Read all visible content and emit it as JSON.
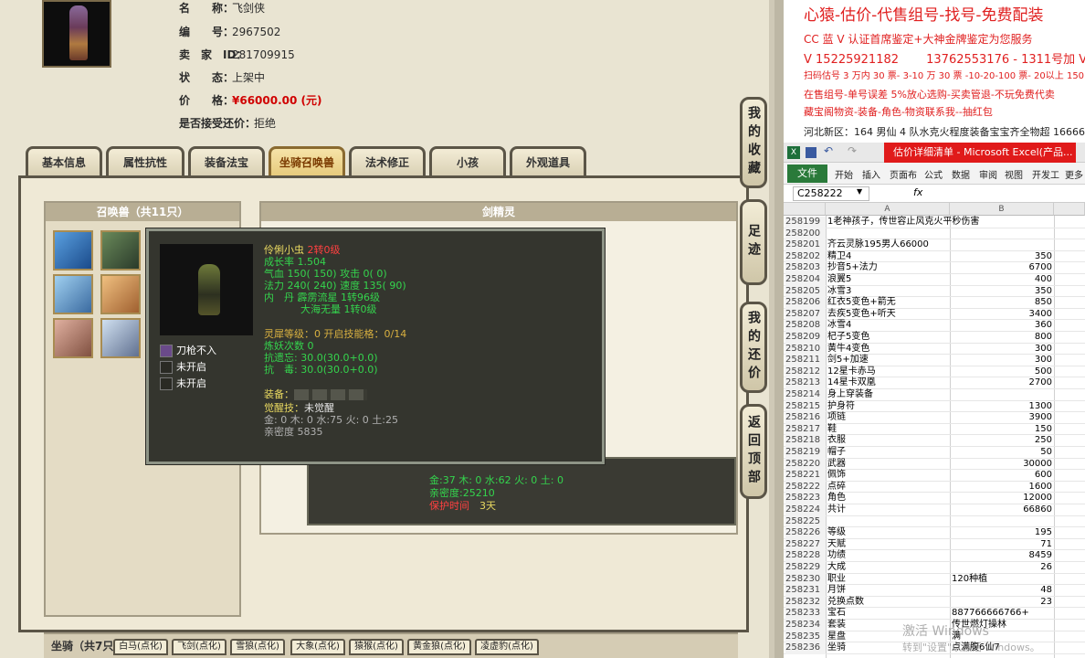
{
  "listing": {
    "name_label": "名　　称：",
    "name": "飞剑侠",
    "id_label": "编　　号：",
    "id": "2967502",
    "seller_label": "卖　家　ID：",
    "seller": "281709915",
    "status_label": "状　　态：",
    "status": "上架中",
    "price_label": "价　　格：",
    "price": "¥66000.00 (元)",
    "bargain_label": "是否接受还价：",
    "bargain": "拒绝"
  },
  "tabs": [
    "基本信息",
    "属性抗性",
    "装备法宝",
    "坐骑召唤兽",
    "法术修正",
    "小孩",
    "外观道具"
  ],
  "pet_panel": {
    "title": "召唤兽（共11只）"
  },
  "detail_panel": {
    "title": "剑精灵"
  },
  "tooltip": {
    "name": "伶俐小虫",
    "level": "2转0级",
    "growth": "成长率 1.504",
    "qi": "气血 150( 150) 攻击 0( 0)",
    "fa": "法力 240( 240) 速度 135( 90)",
    "neidan1": "内　丹 霹雳流星 1转96级",
    "neidan2": "大海无量 1转0级",
    "spirit": "灵犀等级：0 开启技能格：0/14",
    "refine": "炼妖次数 0",
    "resist1": "抗遗忘: 30.0(30.0+0.0)",
    "resist2": "抗　毒: 30.0(30.0+0.0)",
    "equip_label": "装备：",
    "awaken_label": "觉醒技：",
    "awaken": "未觉醒",
    "elements": "金: 0 木: 0 水:75 火: 0 土:25",
    "intimacy": "亲密度 5835",
    "skills": [
      "刀枪不入",
      "未开启",
      "未开启"
    ]
  },
  "second_card": {
    "elements": "金:37 木: 0 水:62 火: 0 土: 0",
    "intimacy": "亲密度:25210",
    "protect_label": "保护时间",
    "protect": "3天"
  },
  "side_buttons": [
    "我的收藏",
    "足迹",
    "我的还价",
    "返回顶部"
  ],
  "mount": {
    "label": "坐骑（共7只）",
    "tabs": [
      "白马(点化)",
      "飞剑(点化)",
      "雪狼(点化)",
      "大象(点化)",
      "猿猴(点化)",
      "黄金狼(点化)",
      "凌虚豹(点化)"
    ]
  },
  "ad": {
    "title": "心猿-估价-代售组号-找号-免费配装",
    "l1": "CC 蓝 V 认证首席鉴定+大神金牌鉴定为您服务",
    "l2": "V 15225921182　　 13762553176 - 1311号加 V",
    "l3": "扫码估号 3 万内 30 票- 3-10 万 30 票 -10-20-100 票- 20以上 150",
    "l4": "在售组号-单号误差 5%放心选购-买卖管退-不玩免费代卖",
    "l5": "藏宝阁物资-装备-角色-物资联系我--抽红包",
    "l6": "河北新区：164 男仙 4 队水克火程度装备宝宝齐全物超 16666"
  },
  "excel": {
    "doc_title": "估价详细清单 - Microsoft Excel(产品...",
    "file_tab": "文件",
    "menu": [
      "开始",
      "插入",
      "页面布",
      "公式",
      "数据",
      "审阅",
      "视图",
      "开发工",
      "更多"
    ],
    "name_box": "C258222",
    "fx": "fx",
    "col_a": "A",
    "col_b": "B",
    "rows": [
      {
        "n": "258199",
        "a": "1老神孩子，传世容止风克火平秒伤害",
        "b": ""
      },
      {
        "n": "258200",
        "a": "",
        "b": ""
      },
      {
        "n": "258201",
        "a": "齐云灵脉195男人66000",
        "b": ""
      },
      {
        "n": "258202",
        "a": "精卫4",
        "b": "350"
      },
      {
        "n": "258203",
        "a": "抄音5+法力",
        "b": "6700"
      },
      {
        "n": "258204",
        "a": "浪翼5",
        "b": "400"
      },
      {
        "n": "258205",
        "a": "冰雪3",
        "b": "350"
      },
      {
        "n": "258206",
        "a": "红衣5变色+箭无",
        "b": "850"
      },
      {
        "n": "258207",
        "a": "去疾5变色+听天",
        "b": "3400"
      },
      {
        "n": "258208",
        "a": "冰雪4",
        "b": "360"
      },
      {
        "n": "258209",
        "a": "杞子5变色",
        "b": "800"
      },
      {
        "n": "258210",
        "a": "黄牛4变色",
        "b": "300"
      },
      {
        "n": "258211",
        "a": "剑5+加速",
        "b": "300"
      },
      {
        "n": "258212",
        "a": "12星卡赤马",
        "b": "500"
      },
      {
        "n": "258213",
        "a": "14星卡双凰",
        "b": "2700"
      },
      {
        "n": "258214",
        "a": "身上穿装备",
        "b": ""
      },
      {
        "n": "258215",
        "a": "护身符",
        "b": "1300"
      },
      {
        "n": "258216",
        "a": "项链",
        "b": "3900"
      },
      {
        "n": "258217",
        "a": "鞋",
        "b": "150"
      },
      {
        "n": "258218",
        "a": "衣服",
        "b": "250"
      },
      {
        "n": "258219",
        "a": "帽子",
        "b": "50"
      },
      {
        "n": "258220",
        "a": "武器",
        "b": "30000"
      },
      {
        "n": "258221",
        "a": "佩饰",
        "b": "600"
      },
      {
        "n": "258222",
        "a": "点碎",
        "b": "1600"
      },
      {
        "n": "258223",
        "a": "角色",
        "b": "12000"
      },
      {
        "n": "258224",
        "a": "共计",
        "b": "66860"
      },
      {
        "n": "258225",
        "a": "",
        "b": ""
      },
      {
        "n": "258226",
        "a": "等级",
        "b": "195"
      },
      {
        "n": "258227",
        "a": "天赋",
        "b": "71"
      },
      {
        "n": "258228",
        "a": "功绩",
        "b": "8459"
      },
      {
        "n": "258229",
        "a": "大成",
        "b": "26"
      },
      {
        "n": "258230",
        "a": "职业",
        "bl": "120种植"
      },
      {
        "n": "258231",
        "a": "月饼",
        "b": "48"
      },
      {
        "n": "258232",
        "a": "兑换点数",
        "b": "23"
      },
      {
        "n": "258233",
        "a": "宝石",
        "bl": "887766666766+"
      },
      {
        "n": "258234",
        "a": "套装",
        "bl": "传世燃灯操林"
      },
      {
        "n": "258235",
        "a": "星盘",
        "bl": "满"
      },
      {
        "n": "258236",
        "a": "坐骑",
        "bl": "点满腹6仙7"
      }
    ],
    "watermark": "激活 Windows",
    "watermark2": "转到\"设置\"以激活 Windows。"
  }
}
